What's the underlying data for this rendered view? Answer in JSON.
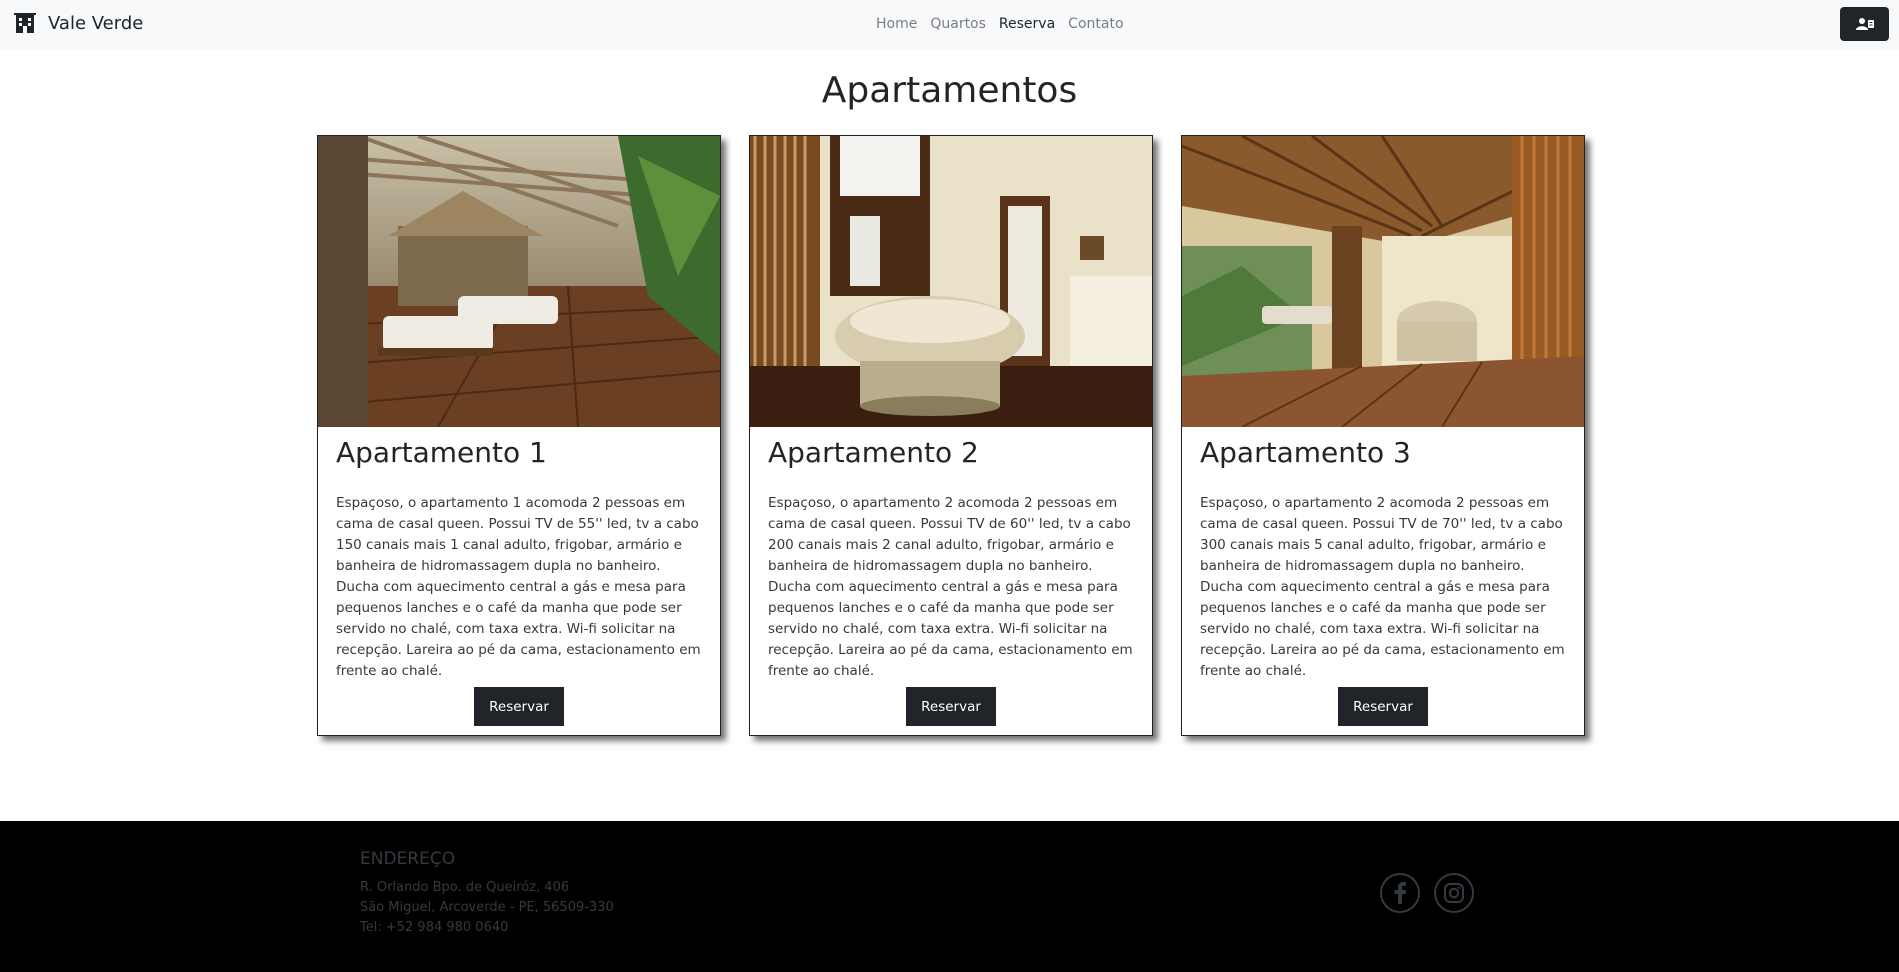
{
  "navbar": {
    "brand": "Vale Verde",
    "brand_icon": "hotel-building-icon",
    "links": [
      {
        "label": "Home",
        "active": false
      },
      {
        "label": "Quartos",
        "active": false
      },
      {
        "label": "Reserva",
        "active": true
      },
      {
        "label": "Contato",
        "active": false
      }
    ],
    "user_icon": "user-card-icon"
  },
  "main": {
    "title": "Apartamentos",
    "cards": [
      {
        "title": "Apartamento 1",
        "image": "deck-with-loungers",
        "description": "Espaçoso, o apartamento 1 acomoda 2 pessoas em cama de casal queen. Possui TV de 55'' led, tv a cabo 150 canais mais 1 canal adulto, frigobar, armário e banheira de hidromassagem dupla no banheiro. Ducha com aquecimento central a gás e mesa para pequenos lanches e o café da manha que pode ser servido no chalé, com taxa extra. Wi-fi solicitar na recepção. Lareira ao pé da cama, estacionamento em frente ao chalé.",
        "button": "Reservar"
      },
      {
        "title": "Apartamento 2",
        "image": "bathroom-with-tub",
        "description": "Espaçoso, o apartamento 2 acomoda 2 pessoas em cama de casal queen. Possui TV de 60'' led, tv a cabo 200 canais mais 2 canal adulto, frigobar, armário e banheira de hidromassagem dupla no banheiro. Ducha com aquecimento central a gás e mesa para pequenos lanches e o café da manha que pode ser servido no chalé, com taxa extra. Wi-fi solicitar na recepção. Lareira ao pé da cama, estacionamento em frente ao chalé.",
        "button": "Reservar"
      },
      {
        "title": "Apartamento 3",
        "image": "open-room-with-tub",
        "description": "Espaçoso, o apartamento 2 acomoda 2 pessoas em cama de casal queen. Possui TV de 70'' led, tv a cabo 300 canais mais 5 canal adulto, frigobar, armário e banheira de hidromassagem dupla no banheiro. Ducha com aquecimento central a gás e mesa para pequenos lanches e o café da manha que pode ser servido no chalé, com taxa extra. Wi-fi solicitar na recepção. Lareira ao pé da cama, estacionamento em frente ao chalé.",
        "button": "Reservar"
      }
    ]
  },
  "footer": {
    "address_title": "ENDEREÇO",
    "address_lines": [
      "R. Orlando Bpo. de Queiróz, 406",
      "São Miguel, Arcoverde - PE, 56509-330",
      "Tel: +52 984 980 0640"
    ],
    "social": [
      "facebook-icon",
      "instagram-icon"
    ]
  },
  "colors": {
    "navbar_bg": "#f8f9fa",
    "dark": "#212529",
    "footer_bg": "#000000",
    "footer_text": "#343a40"
  }
}
